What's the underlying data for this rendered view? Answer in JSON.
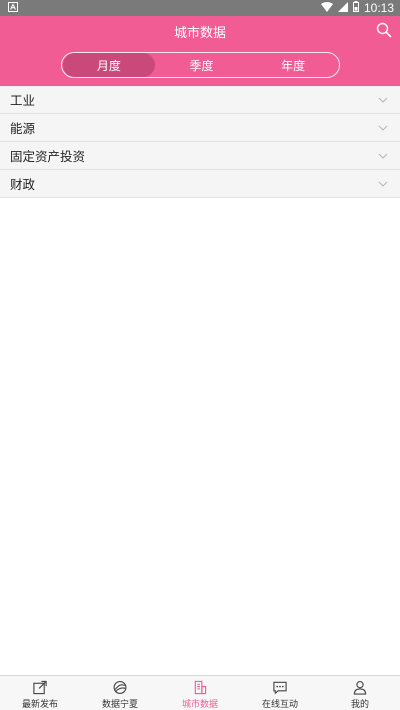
{
  "status_bar": {
    "time": "10:13"
  },
  "header": {
    "title": "城市数据"
  },
  "segments": [
    {
      "label": "月度",
      "active": true
    },
    {
      "label": "季度",
      "active": false
    },
    {
      "label": "年度",
      "active": false
    }
  ],
  "categories": [
    {
      "label": "工业"
    },
    {
      "label": "能源"
    },
    {
      "label": "固定资产投资"
    },
    {
      "label": "财政"
    }
  ],
  "tabbar": {
    "items": [
      {
        "label": "最新发布",
        "icon": "share-out-icon",
        "active": false
      },
      {
        "label": "数据宁夏",
        "icon": "globe-icon",
        "active": false
      },
      {
        "label": "城市数据",
        "icon": "building-icon",
        "active": true
      },
      {
        "label": "在线互动",
        "icon": "chat-icon",
        "active": false
      },
      {
        "label": "我的",
        "icon": "user-icon",
        "active": false
      }
    ]
  },
  "colors": {
    "brand": "#f15c95",
    "active_segment": "#c9497a",
    "status_bar": "#7a7a7a"
  }
}
